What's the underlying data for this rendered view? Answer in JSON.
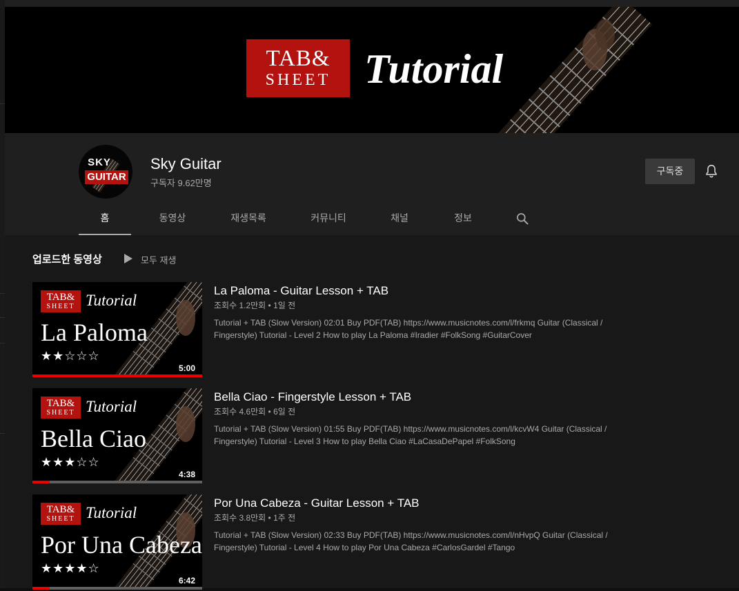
{
  "banner": {
    "logo_line1": "TAB&",
    "logo_line2": "SHEET",
    "title": "Tutorial"
  },
  "channel": {
    "avatar_line1": "SKY",
    "avatar_line2": "GUITAR",
    "name": "Sky Guitar",
    "subscribers": "구독자 9.62만명",
    "subscribe_label": "구독중",
    "bell_icon": "bell-icon"
  },
  "tabs": [
    {
      "label": "홈",
      "active": true
    },
    {
      "label": "동영상"
    },
    {
      "label": "재생목록"
    },
    {
      "label": "커뮤니티"
    },
    {
      "label": "채널"
    },
    {
      "label": "정보"
    }
  ],
  "search_icon": "search-icon",
  "section": {
    "title": "업로드한 동영상",
    "play_all": "모두 재생",
    "play_icon": "play-icon"
  },
  "videos": [
    {
      "thumb_logo1": "TAB&",
      "thumb_logo2": "SHEET",
      "thumb_tutorial": "Tutorial",
      "thumb_title": "La Paloma",
      "thumb_stars": "★★☆☆☆",
      "duration": "5:00",
      "watched_fraction": 1.0,
      "title": "La Paloma - Guitar Lesson + TAB",
      "meta": "조회수 1.2만회 • 1일 전",
      "description": "Tutorial + TAB (Slow Version) 02:01 Buy PDF(TAB) https://www.musicnotes.com/l/frkmq Guitar (Classical / Fingerstyle) Tutorial - Level 2 How to play La Paloma #Iradier #FolkSong #GuitarCover"
    },
    {
      "thumb_logo1": "TAB&",
      "thumb_logo2": "SHEET",
      "thumb_tutorial": "Tutorial",
      "thumb_title": "Bella Ciao",
      "thumb_stars": "★★★☆☆",
      "duration": "4:38",
      "watched_fraction": 0.1,
      "title": "Bella Ciao - Fingerstyle Lesson + TAB",
      "meta": "조회수 4.6만회 • 6일 전",
      "description": "Tutorial + TAB (Slow Version) 01:55 Buy PDF(TAB) https://www.musicnotes.com/l/kcvW4 Guitar (Classical / Fingerstyle) Tutorial - Level 3 How to play Bella Ciao #LaCasaDePapel #FolkSong"
    },
    {
      "thumb_logo1": "TAB&",
      "thumb_logo2": "SHEET",
      "thumb_tutorial": "Tutorial",
      "thumb_title": "Por Una Cabeza",
      "thumb_stars": "★★★★☆",
      "duration": "6:42",
      "watched_fraction": 0.1,
      "title": "Por Una Cabeza - Guitar Lesson + TAB",
      "meta": "조회수 3.8만회 • 1주 전",
      "description": "Tutorial + TAB (Slow Version) 02:33 Buy PDF(TAB) https://www.musicnotes.com/l/nHvpQ Guitar (Classical / Fingerstyle) Tutorial - Level 4 How to play Por Una Cabeza #CarlosGardel #Tango"
    }
  ],
  "colors": {
    "brand_red": "#b3120f",
    "progress_red": "#e00000",
    "header_bg": "#1f1f1f",
    "content_bg": "#181818"
  }
}
